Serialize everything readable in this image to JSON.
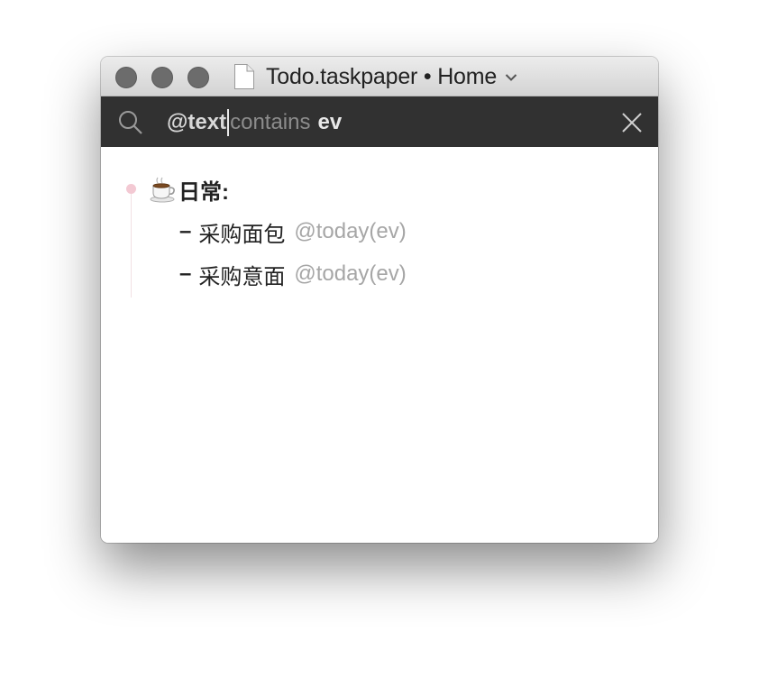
{
  "window": {
    "title": "Todo.taskpaper • Home",
    "traffic_lights": [
      "close",
      "minimize",
      "zoom"
    ],
    "title_icon": "document-icon"
  },
  "search": {
    "attribute": "@text",
    "operator": "contains",
    "value": "ev",
    "icon": "search-icon",
    "clear_icon": "close-icon"
  },
  "outline": {
    "project": {
      "icon": "coffee-cup",
      "label": "日常:"
    },
    "tasks": [
      {
        "dash": "–",
        "text": "采购面包",
        "tag": "@today(ev)"
      },
      {
        "dash": "–",
        "text": "采购意面",
        "tag": "@today(ev)"
      }
    ]
  },
  "colors": {
    "search_bar_bg": "#313131",
    "tag_text": "#a6a6a6",
    "handle_pink": "#f3c9d3"
  }
}
